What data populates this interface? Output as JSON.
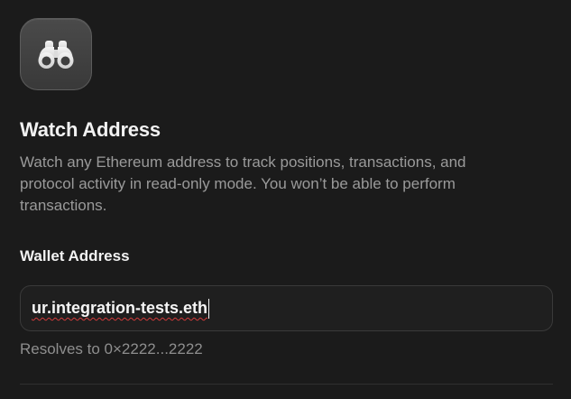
{
  "header": {
    "icon": "binoculars-icon",
    "title": "Watch Address",
    "description": "Watch any Ethereum address to track positions, transactions, and protocol activity in read-only mode. You won’t be able to perform transactions."
  },
  "wallet": {
    "label": "Wallet Address",
    "value": "ur.integration-tests.eth",
    "resolves_text": "Resolves to 0×2222...2222"
  }
}
